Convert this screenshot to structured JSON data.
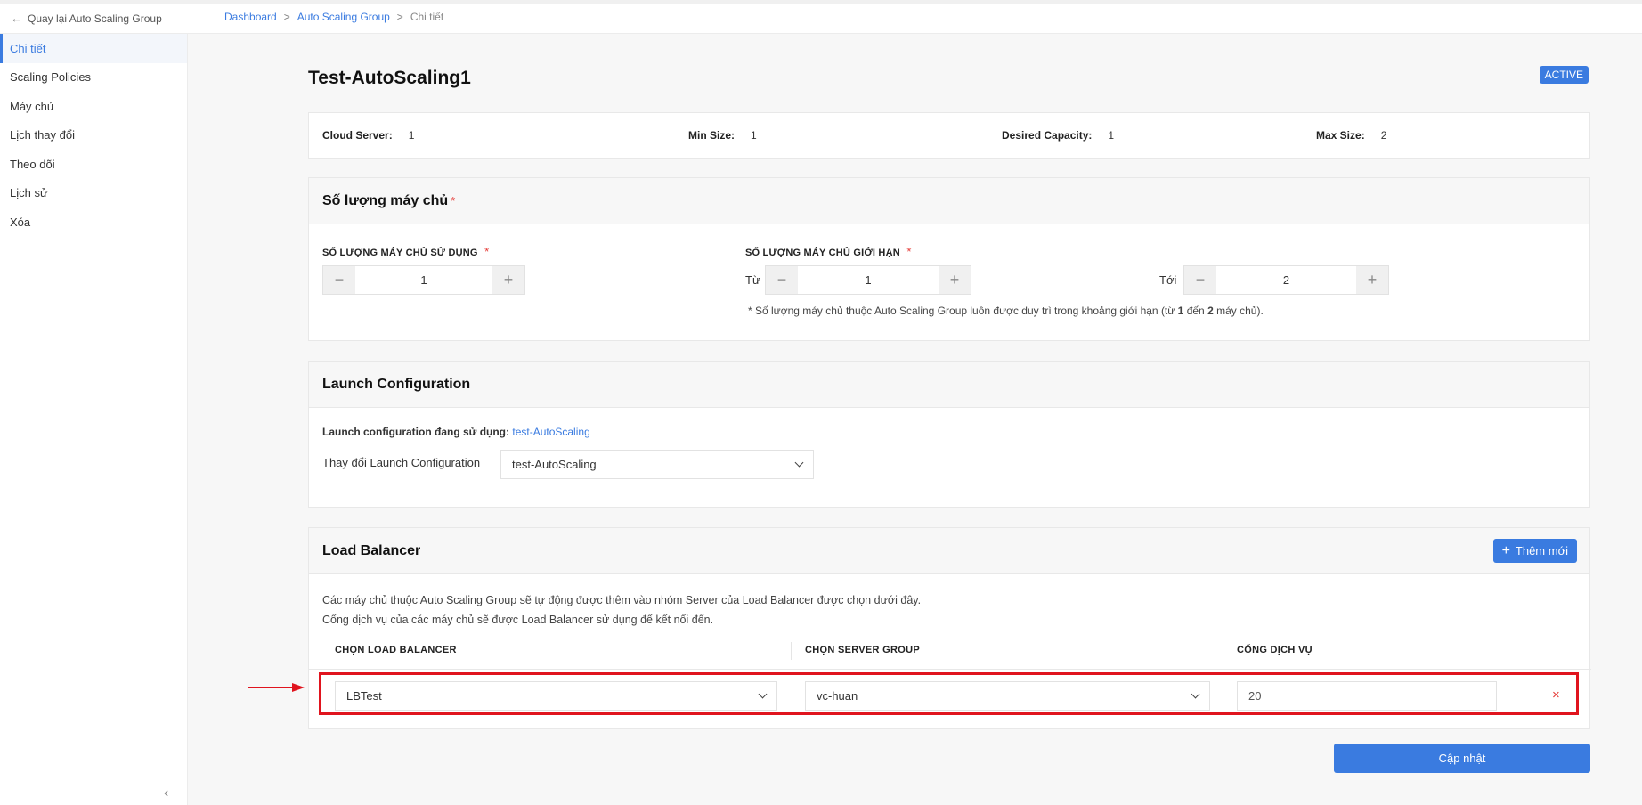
{
  "topbar": {
    "back_label": "Quay lại Auto Scaling Group",
    "breadcrumb": [
      "Dashboard",
      "Auto Scaling Group",
      "Chi tiết"
    ],
    "separator": ">"
  },
  "sidebar": {
    "items": [
      {
        "label": "Chi tiết",
        "active": true
      },
      {
        "label": "Scaling Policies"
      },
      {
        "label": "Máy chủ"
      },
      {
        "label": "Lịch thay đổi"
      },
      {
        "label": "Theo dõi"
      },
      {
        "label": "Lịch sử"
      },
      {
        "label": "Xóa"
      }
    ],
    "collapse_icon": "chevron-left-icon"
  },
  "page": {
    "title": "Test-AutoScaling1",
    "status": "ACTIVE"
  },
  "summary": {
    "cloud_server_label": "Cloud Server:",
    "cloud_server_value": "1",
    "min_size_label": "Min Size:",
    "min_size_value": "1",
    "desired_label": "Desired Capacity:",
    "desired_value": "1",
    "max_size_label": "Max Size:",
    "max_size_value": "2"
  },
  "server_count": {
    "title": "Số lượng máy chủ",
    "required_mark": "*",
    "used_label": "SỐ LƯỢNG MÁY CHỦ SỬ DỤNG",
    "used_value": "1",
    "limit_label": "SỐ LƯỢNG MÁY CHỦ GIỚI HẠN",
    "from_label": "Từ",
    "from_value": "1",
    "to_label": "Tới",
    "to_value": "2",
    "note_prefix": "* Số lượng máy chủ thuộc Auto Scaling Group luôn được duy trì trong khoảng giới hạn (từ",
    "note_from": "1",
    "note_mid": "đến",
    "note_to": "2",
    "note_suffix": "máy chủ).",
    "minus": "−",
    "plus": "+"
  },
  "launch_config": {
    "title": "Launch Configuration",
    "current_label": "Launch configuration đang sử dụng:",
    "current_value": "test-AutoScaling",
    "change_label": "Thay đổi Launch Configuration",
    "selected": "test-AutoScaling"
  },
  "load_balancer": {
    "title": "Load Balancer",
    "add_label": "Thêm mới",
    "desc_line1": "Các máy chủ thuộc Auto Scaling Group sẽ tự động được thêm vào nhóm Server của Load Balancer được chọn dưới đây.",
    "desc_line2": "Cổng dịch vụ của các máy chủ sẽ được Load Balancer sử dụng để kết nối đến.",
    "columns": [
      "CHỌN LOAD BALANCER",
      "CHỌN SERVER GROUP",
      "CỔNG DỊCH VỤ"
    ],
    "row": {
      "load_balancer": "LBTest",
      "server_group": "vc-huan",
      "port": "20"
    },
    "remove_icon": "×"
  },
  "actions": {
    "update_label": "Cập nhật"
  },
  "colors": {
    "accent": "#3a7be0",
    "highlight": "#e0141e"
  }
}
